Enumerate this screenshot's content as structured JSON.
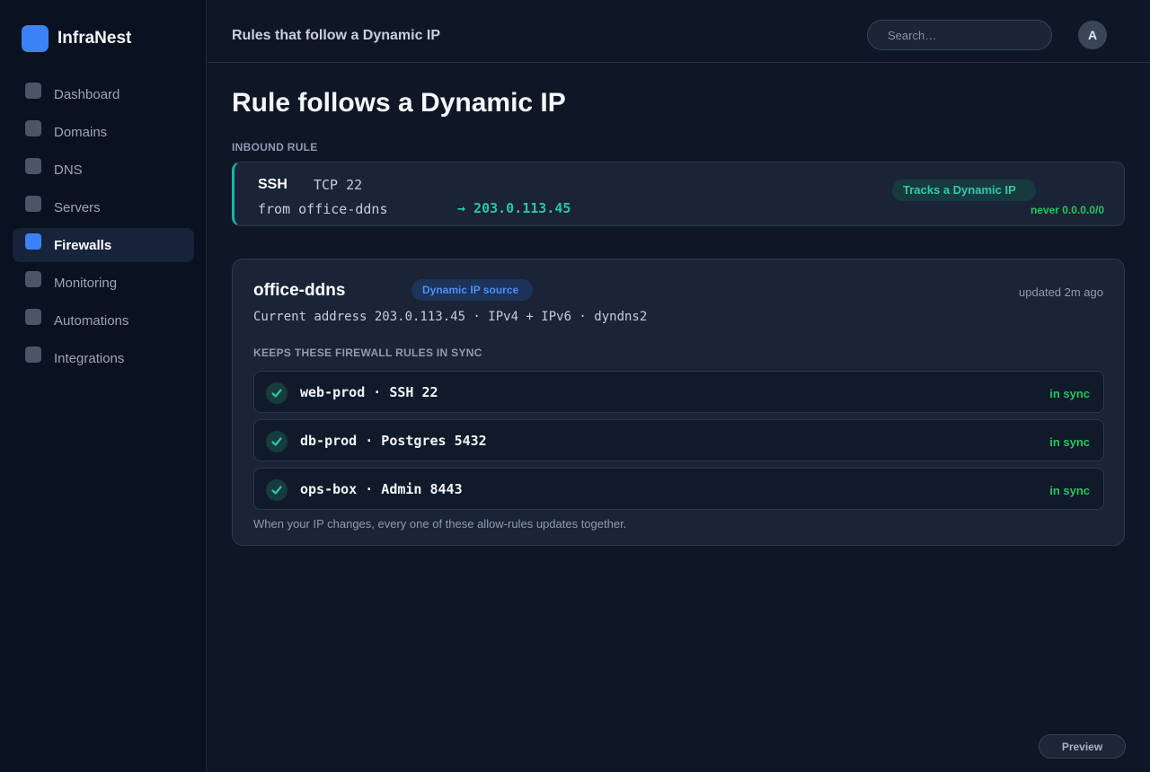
{
  "app": {
    "name": "InfraNest"
  },
  "sidebar": {
    "items": [
      {
        "label": "Dashboard",
        "active": false
      },
      {
        "label": "Domains",
        "active": false
      },
      {
        "label": "DNS",
        "active": false
      },
      {
        "label": "Servers",
        "active": false
      },
      {
        "label": "Firewalls",
        "active": true
      },
      {
        "label": "Monitoring",
        "active": false
      },
      {
        "label": "Automations",
        "active": false
      },
      {
        "label": "Integrations",
        "active": false
      }
    ]
  },
  "header": {
    "title": "Rules that follow a Dynamic IP",
    "search_placeholder": "Search…",
    "avatar_initial": "A"
  },
  "main": {
    "title": "Rule follows a Dynamic IP",
    "inbound": {
      "section_label": "INBOUND RULE",
      "protocol": "SSH",
      "port": "TCP 22",
      "source": "from office-ddns",
      "resolved": "→ 203.0.113.45",
      "badge": "Tracks a Dynamic IP",
      "note": "never 0.0.0.0/0"
    },
    "source": {
      "name": "office-ddns",
      "badge": "Dynamic IP source",
      "updated": "updated 2m ago",
      "current": "Current address 203.0.113.45 · IPv4 + IPv6 · dyndns2",
      "rules_label": "KEEPS THESE FIREWALL RULES IN SYNC",
      "rules": [
        {
          "label": "web-prod · SSH 22",
          "status": "in sync"
        },
        {
          "label": "db-prod · Postgres 5432",
          "status": "in sync"
        },
        {
          "label": "ops-box · Admin 8443",
          "status": "in sync"
        }
      ],
      "footnote": "When your IP changes, every one of these allow-rules updates together."
    }
  },
  "footer": {
    "preview_label": "Preview"
  },
  "colors": {
    "accent": "#3b82f6",
    "teal": "#14b8a6",
    "success": "#22c55e",
    "background": "#0f1727"
  }
}
